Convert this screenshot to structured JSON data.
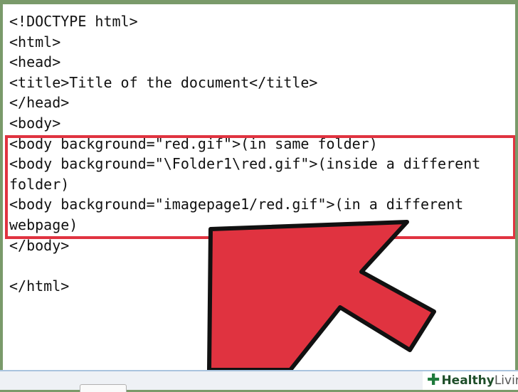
{
  "editor": {
    "lines": [
      "<!DOCTYPE html>",
      "<html>",
      "<head>",
      "<title>Title of the document</title>",
      "</head>",
      "<body>",
      "<body background=\"red.gif\">(in same folder)",
      "<body background=\"\\Folder1\\red.gif\">(inside a different",
      "folder)",
      "<body background=\"imagepage1/red.gif\">(in a different",
      "webpage)",
      "</body>",
      "",
      "</html>"
    ]
  },
  "annotation": {
    "box_color": "#e03340",
    "arrow_color": "#e03340",
    "arrow_outline": "#111111"
  },
  "watermark": {
    "icon": "plus-icon",
    "word1": "Healthy",
    "word2": "Living"
  }
}
